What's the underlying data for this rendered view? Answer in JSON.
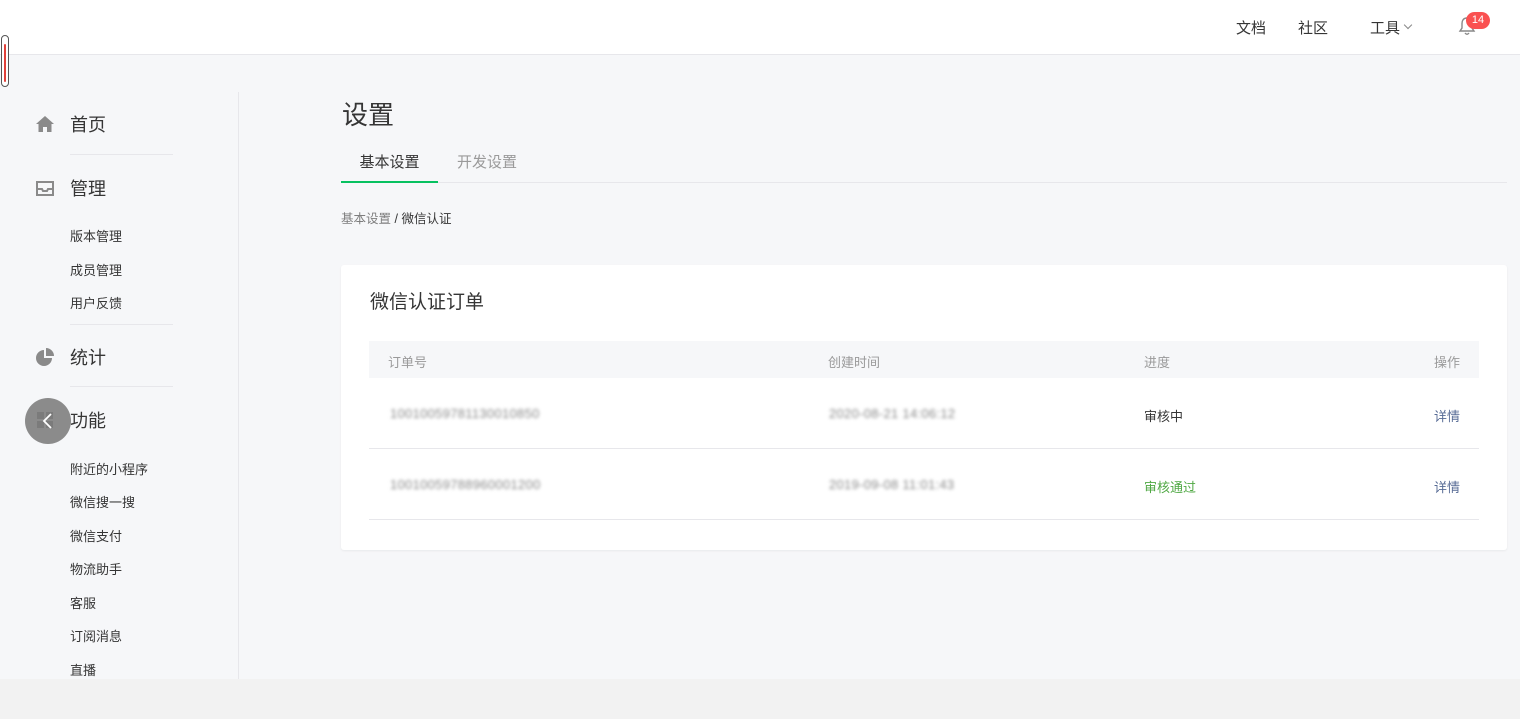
{
  "topbar": {
    "links": [
      "文档",
      "社区"
    ],
    "tools_label": "工具",
    "notification_count": "14"
  },
  "sidebar": {
    "home": "首页",
    "manage": "管理",
    "manage_items": [
      "版本管理",
      "成员管理",
      "用户反馈"
    ],
    "stats": "统计",
    "features": "功能",
    "feature_items": [
      "附近的小程序",
      "微信搜一搜",
      "微信支付",
      "物流助手",
      "客服",
      "订阅消息",
      "直播"
    ]
  },
  "main": {
    "title": "设置",
    "tabs": [
      "基本设置",
      "开发设置"
    ],
    "breadcrumb": {
      "parent": "基本设置",
      "separator": " / ",
      "current": "微信认证"
    },
    "card": {
      "title": "微信认证订单",
      "columns": [
        "订单号",
        "创建时间",
        "进度",
        "操作"
      ],
      "rows": [
        {
          "order_no": "10010059781130010850",
          "created": "2020-08-21 14:06:12",
          "status": "审核中",
          "action": "详情"
        },
        {
          "order_no": "10010059788960001200",
          "created": "2019-09-08 11:01:43",
          "status": "审核通过",
          "action": "详情"
        }
      ]
    }
  },
  "colors": {
    "accent": "#07c160",
    "link": "#576b95",
    "approved": "#4fa843",
    "badge": "#fa5151"
  }
}
